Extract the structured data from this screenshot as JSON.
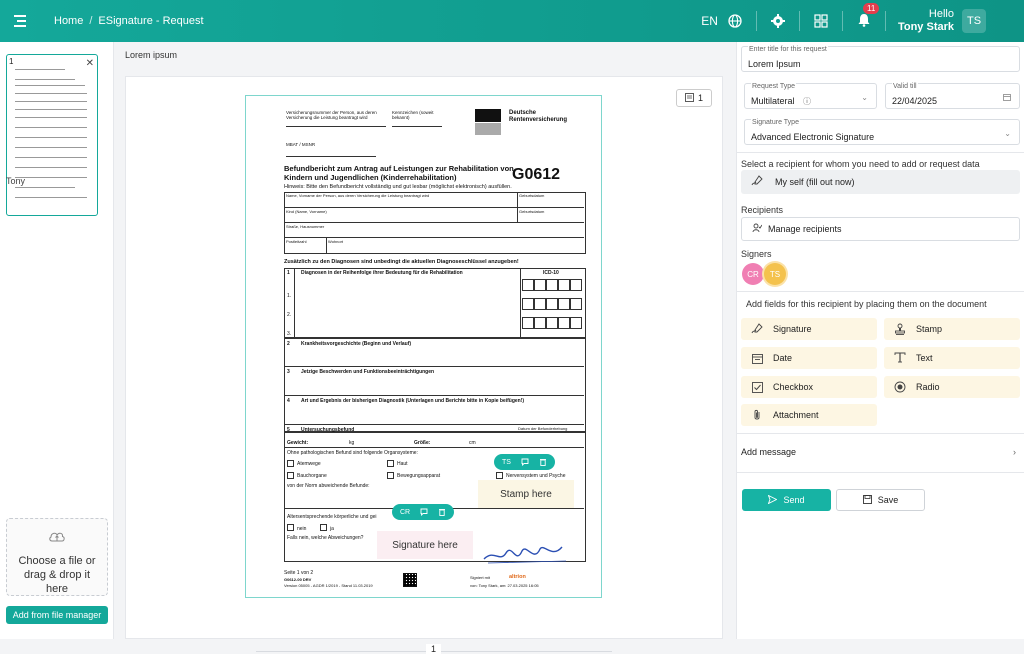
{
  "header": {
    "breadcrumb": [
      "Home",
      "ESignature - Request"
    ],
    "breadcrumb_sep": "/",
    "language": "EN",
    "notification_count": "11",
    "greeting": "Hello",
    "user_name": "Tony Stark",
    "user_initials": "TS",
    "icons": [
      "menu-toggle-icon",
      "globe-icon",
      "gear-icon",
      "grid-icon",
      "bell-icon"
    ]
  },
  "sidebar": {
    "thumbnail_number": "1",
    "thumbnail_owner": "Tony",
    "upload_text": "Choose a file or drag & drop it here",
    "file_manager_label": "Add from file manager"
  },
  "document": {
    "title": "Lorem ipsum",
    "page_counter": "1",
    "page_number_footer": "1",
    "form": {
      "header_left": "Versicherungsnummer der Person, aus deren Versicherung die Leistung beantragt wird",
      "header_mid": "Kennzeichen (soweit bekannt)",
      "logo_line1": "Deutsche",
      "logo_line2": "Rentenversicherung",
      "mbat": "MBAT / MSNR",
      "title": "Befundbericht zum Antrag auf Leistungen zur Rehabilitation von Kindern und Jugendlichen (Kinderrehabilitation)",
      "code": "G0612",
      "hint": "Hinweis: Bitte den Befundbericht vollständig und gut lesbar (möglichst elektronisch) ausfüllen.",
      "row_name": "Name, Vorname der Person, aus deren Versicherung die Leistung beantragt wird",
      "row_geb": "Geburtsdatum",
      "row_kind": "Kind (Name, Vorname)",
      "row_strasse": "Straße, Hausnummer",
      "row_plz": "Postleitzahl",
      "row_wohnort": "Wohnort",
      "diag_heading": "Zusätzlich zu den Diagnosen sind unbedingt die aktuellen Diagnoseschlüssel anzugeben!",
      "s1": "Diagnosen in der Reihenfolge ihrer Bedeutung für die Rehabilitation",
      "icd": "ICD-10",
      "n1": "1.",
      "n2": "2.",
      "n3": "3.",
      "s1_num": "1",
      "s2_num": "2",
      "s3_num": "3",
      "s4_num": "4",
      "s5_num": "5",
      "s2": "Krankheitsvorgeschichte (Beginn und Verlauf)",
      "s3": "Jetzige Beschwerden und Funktionsbeeinträchtigungen",
      "s4": "Art und Ergebnis der bisherigen Diagnostik (Unterlagen und Berichte bitte in Kopie beifügen!)",
      "s5": "Untersuchungsbefund",
      "datum_befund": "Datum der Befunderhebung",
      "gewicht": "Gewicht:",
      "kg": "kg",
      "groesse": "Größe:",
      "cm": "cm",
      "ohne": "Ohne pathologischen Befund sind folgende Organsysteme:",
      "c1": "Atemwege",
      "c2": "Haut",
      "c3": "Bauchorgane",
      "c4": "Bewegungsapparat",
      "c5": "Nervensystem und Psyche",
      "norm": "von der Norm abweichende Befunde:",
      "alter": "Altersentsprechende körperliche und gei",
      "nein": "nein",
      "ja": "ja",
      "falls": "Falls nein, welche Abweichungen?",
      "seite": "Seite 1 von 2",
      "version1": "G0612-00 DRV",
      "version2": "Version 05005 - AGDR 1/2019 - Stand 11.03.2019",
      "signed_label": "Signiert mit",
      "signed_brand": "altrion",
      "signed_by": "von: Tony Stark, am: 27.03.2025 16:05"
    },
    "placed_fields": {
      "ts_pill": "TS",
      "cr_pill": "CR",
      "stamp_placeholder": "Stamp here",
      "signature_placeholder": "Signature here"
    }
  },
  "form_panel": {
    "title_label": "Enter title for this request",
    "title_value": "Lorem Ipsum",
    "request_type_label": "Request Type",
    "request_type_value": "Multilateral",
    "valid_till_label": "Valid till",
    "valid_till_value": "22/04/2025",
    "signature_type_label": "Signature Type",
    "signature_type_value": "Advanced Electronic Signature",
    "recipient_prompt": "Select a recipient for whom you need to add or request data",
    "self_option": "My self (fill out now)",
    "recipients_label": "Recipients",
    "manage_recipients": "Manage recipients",
    "signers_label": "Signers",
    "signers": [
      {
        "initials": "CR",
        "color": "#f07fb3"
      },
      {
        "initials": "TS",
        "color": "#f4c24d"
      }
    ],
    "palette_title": "Add fields for this recipient by placing them on the document",
    "tools": [
      {
        "label": "Signature",
        "icon": "signature-icon"
      },
      {
        "label": "Stamp",
        "icon": "stamp-icon"
      },
      {
        "label": "Date",
        "icon": "calendar-icon"
      },
      {
        "label": "Text",
        "icon": "text-icon"
      },
      {
        "label": "Checkbox",
        "icon": "checkbox-icon"
      },
      {
        "label": "Radio",
        "icon": "radio-icon"
      },
      {
        "label": "Attachment",
        "icon": "paperclip-icon"
      }
    ],
    "add_message": "Add message",
    "send_label": "Send",
    "save_label": "Save"
  },
  "colors": {
    "brand": "#14a89a",
    "tool_bg": "#fdf6e3",
    "badge": "#e33d4d"
  }
}
